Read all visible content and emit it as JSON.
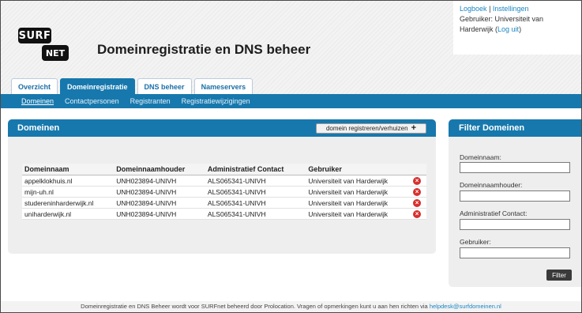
{
  "header": {
    "logo_surf": "SURF",
    "logo_net": "NET",
    "title": "Domeinregistratie en DNS beheer"
  },
  "user_box": {
    "logbook": "Logboek",
    "separator": "|",
    "settings": "Instellingen",
    "user_label": "Gebruiker: Universiteit van",
    "user_label_2": "Harderwijk",
    "logout": "Log uit"
  },
  "tabs": [
    {
      "label": "Overzicht"
    },
    {
      "label": "Domeinregistratie"
    },
    {
      "label": "DNS beheer"
    },
    {
      "label": "Nameservers"
    }
  ],
  "subnav": [
    {
      "label": "Domeinen"
    },
    {
      "label": "Contactpersonen"
    },
    {
      "label": "Registranten"
    },
    {
      "label": "Registratiewijzigingen"
    }
  ],
  "domains_panel": {
    "title": "Domeinen",
    "add_button": "domein registreren/verhuizen",
    "add_icon": "+",
    "columns": [
      "Domeinnaam",
      "Domeinnaamhouder",
      "Administratief Contact",
      "Gebruiker"
    ],
    "rows": [
      {
        "domain": "appelklokhuis.nl",
        "holder": "UNH023894-UNIVH",
        "admin": "ALS065341-UNIVH",
        "user": "Universiteit van Harderwijk"
      },
      {
        "domain": "mijn-uh.nl",
        "holder": "UNH023894-UNIVH",
        "admin": "ALS065341-UNIVH",
        "user": "Universiteit van Harderwijk"
      },
      {
        "domain": "studereninharderwijk.nl",
        "holder": "UNH023894-UNIVH",
        "admin": "ALS065341-UNIVH",
        "user": "Universiteit van Harderwijk"
      },
      {
        "domain": "uniharderwijk.nl",
        "holder": "UNH023894-UNIVH",
        "admin": "ALS065341-UNIVH",
        "user": "Universiteit van Harderwijk"
      }
    ],
    "delete_icon": "×"
  },
  "filter_panel": {
    "title": "Filter Domeinen",
    "fields": [
      {
        "label": "Domeinnaam:",
        "value": ""
      },
      {
        "label": "Domeinnaamhouder:",
        "value": ""
      },
      {
        "label": "Administratief Contact:",
        "value": ""
      },
      {
        "label": "Gebruiker:",
        "value": ""
      }
    ],
    "button": "Filter"
  },
  "footer": {
    "text": "Domeinregistratie en DNS Beheer wordt voor SURFnet beheerd door Prolocation. Vragen of opmerkingen kunt u aan hen richten via",
    "email": "helpdesk@surfdomeinen.nl"
  },
  "colors": {
    "accent": "#1778ad",
    "link": "#1a86c4",
    "delete": "#d62f2f"
  }
}
